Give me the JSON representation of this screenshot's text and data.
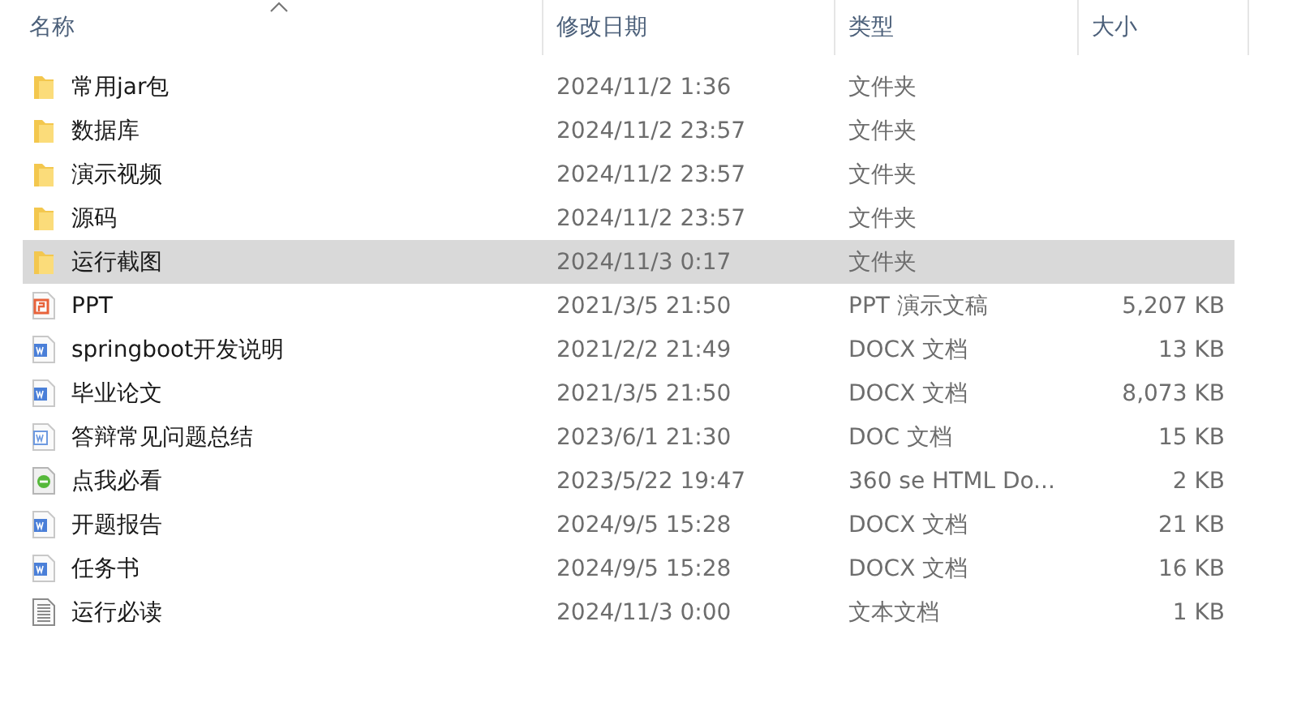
{
  "columns": [
    {
      "label": "名称",
      "sorted": true
    },
    {
      "label": "修改日期",
      "sorted": false
    },
    {
      "label": "类型",
      "sorted": false
    },
    {
      "label": "大小",
      "sorted": false
    }
  ],
  "files": [
    {
      "kind": "folder",
      "name": "常用jar包",
      "modified": "2024/11/2 1:36",
      "type": "文件夹",
      "selected": false
    },
    {
      "kind": "folder",
      "name": "数据库",
      "modified": "2024/11/2 23:57",
      "type": "文件夹",
      "selected": false
    },
    {
      "kind": "folder",
      "name": "演示视频",
      "modified": "2024/11/2 23:57",
      "type": "文件夹",
      "selected": false
    },
    {
      "kind": "folder",
      "name": "源码",
      "modified": "2024/11/2 23:57",
      "type": "文件夹",
      "selected": false
    },
    {
      "kind": "folder",
      "name": "运行截图",
      "modified": "2024/11/3 0:17",
      "type": "文件夹",
      "selected": true
    },
    {
      "kind": "ppt",
      "name": "PPT",
      "modified": "2021/3/5 21:50",
      "type": "PPT 演示文稿",
      "size": "5,207 KB",
      "selected": false
    },
    {
      "kind": "docx",
      "name": "springboot开发说明",
      "modified": "2021/2/2 21:49",
      "type": "DOCX 文档",
      "size": "13 KB",
      "selected": false
    },
    {
      "kind": "docx",
      "name": "毕业论文",
      "modified": "2021/3/5 21:50",
      "type": "DOCX 文档",
      "size": "8,073 KB",
      "selected": false
    },
    {
      "kind": "doc",
      "name": "答辩常见问题总结",
      "modified": "2023/6/1 21:30",
      "type": "DOC 文档",
      "size": "15 KB",
      "selected": false
    },
    {
      "kind": "html",
      "name": "点我必看",
      "modified": "2023/5/22 19:47",
      "type": "360 se HTML Do...",
      "size": "2 KB",
      "selected": false
    },
    {
      "kind": "docx",
      "name": "开题报告",
      "modified": "2024/9/5 15:28",
      "type": "DOCX 文档",
      "size": "21 KB",
      "selected": false
    },
    {
      "kind": "docx",
      "name": "任务书",
      "modified": "2024/9/5 15:28",
      "type": "DOCX 文档",
      "size": "16 KB",
      "selected": false
    },
    {
      "kind": "text",
      "name": "运行必读",
      "modified": "2024/11/3 0:00",
      "type": "文本文档",
      "size": "1 KB",
      "selected": false
    }
  ]
}
